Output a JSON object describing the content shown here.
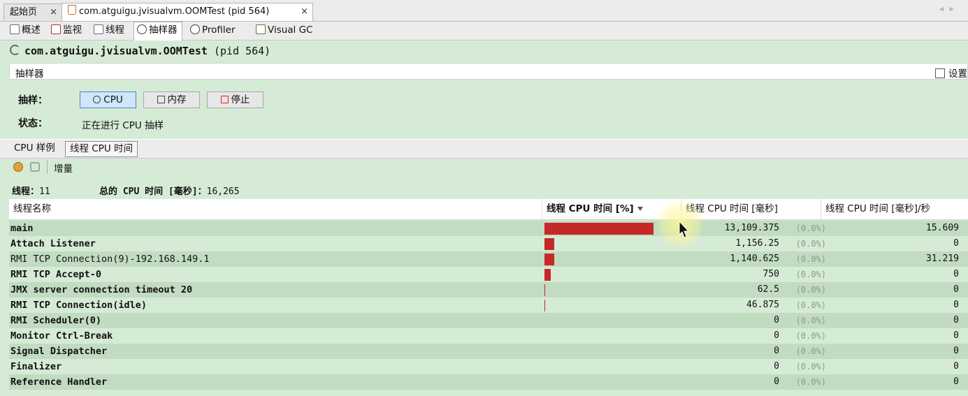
{
  "doc_tabs": [
    {
      "label": "起始页",
      "close": "×"
    },
    {
      "label": "com.atguigu.jvisualvm.OOMTest (pid 564)",
      "close": "×"
    }
  ],
  "view_tabs": [
    {
      "label": "概述",
      "icon": "overview-icon"
    },
    {
      "label": "监视",
      "icon": "monitor-icon"
    },
    {
      "label": "线程",
      "icon": "threads-icon"
    },
    {
      "label": "抽样器",
      "icon": "sampler-icon"
    },
    {
      "label": "Profiler",
      "icon": "profiler-icon"
    },
    {
      "label": "Visual GC",
      "icon": "visualgc-icon"
    }
  ],
  "header": {
    "title": "com.atguigu.jvisualvm.OOMTest",
    "pid": "(pid 564)"
  },
  "sampler": {
    "section_label": "抽样器",
    "settings_label": "设置",
    "sample_label": "抽样：",
    "status_label": "状态：",
    "status_value": "正在进行 CPU 抽样",
    "buttons": {
      "cpu": "CPU",
      "memory": "内存",
      "stop": "停止"
    }
  },
  "inner_tabs": [
    {
      "label": "CPU 样例"
    },
    {
      "label": "线程 CPU 时间"
    }
  ],
  "toolbar": {
    "delta_label": "增量"
  },
  "summary": {
    "threads_label": "线程：",
    "threads_value": "11",
    "total_label": "总的 CPU 时间 [毫秒]：",
    "total_value": "16,265"
  },
  "table": {
    "columns": [
      "线程名称",
      "线程 CPU 时间 [%]",
      "线程 CPU 时间 [毫秒]",
      "线程 CPU 时间 [毫秒]/秒"
    ],
    "rows": [
      {
        "name": "main",
        "pct": 80.6,
        "ms": "13,109.375",
        "pct_text": "(0.0%)",
        "rate": "15.609",
        "bold": true
      },
      {
        "name": "Attach Listener",
        "pct": 7.1,
        "ms": "1,156.25",
        "pct_text": "(0.0%)",
        "rate": "0",
        "bold": true
      },
      {
        "name": "RMI TCP Connection(9)-192.168.149.1",
        "pct": 7.0,
        "ms": "1,140.625",
        "pct_text": "(0.0%)",
        "rate": "31.219",
        "bold": false
      },
      {
        "name": "RMI TCP Accept-0",
        "pct": 4.6,
        "ms": "750",
        "pct_text": "(0.0%)",
        "rate": "0",
        "bold": true
      },
      {
        "name": "JMX server connection timeout 20",
        "pct": 0.4,
        "ms": "62.5",
        "pct_text": "(0.0%)",
        "rate": "0",
        "bold": true
      },
      {
        "name": "RMI TCP Connection(idle)",
        "pct": 0.3,
        "ms": "46.875",
        "pct_text": "(0.0%)",
        "rate": "0",
        "bold": true
      },
      {
        "name": "RMI Scheduler(0)",
        "pct": 0,
        "ms": "0",
        "pct_text": "(0.0%)",
        "rate": "0",
        "bold": true
      },
      {
        "name": "Monitor Ctrl-Break",
        "pct": 0,
        "ms": "0",
        "pct_text": "(0.0%)",
        "rate": "0",
        "bold": true
      },
      {
        "name": "Signal Dispatcher",
        "pct": 0,
        "ms": "0",
        "pct_text": "(0.0%)",
        "rate": "0",
        "bold": true
      },
      {
        "name": "Finalizer",
        "pct": 0,
        "ms": "0",
        "pct_text": "(0.0%)",
        "rate": "0",
        "bold": true
      },
      {
        "name": "Reference Handler",
        "pct": 0,
        "ms": "0",
        "pct_text": "(0.0%)",
        "rate": "0",
        "bold": true
      }
    ]
  },
  "colors": {
    "bar": "#c62828",
    "background": "#d6ebd6",
    "row_alt": "#c1dcc1"
  }
}
